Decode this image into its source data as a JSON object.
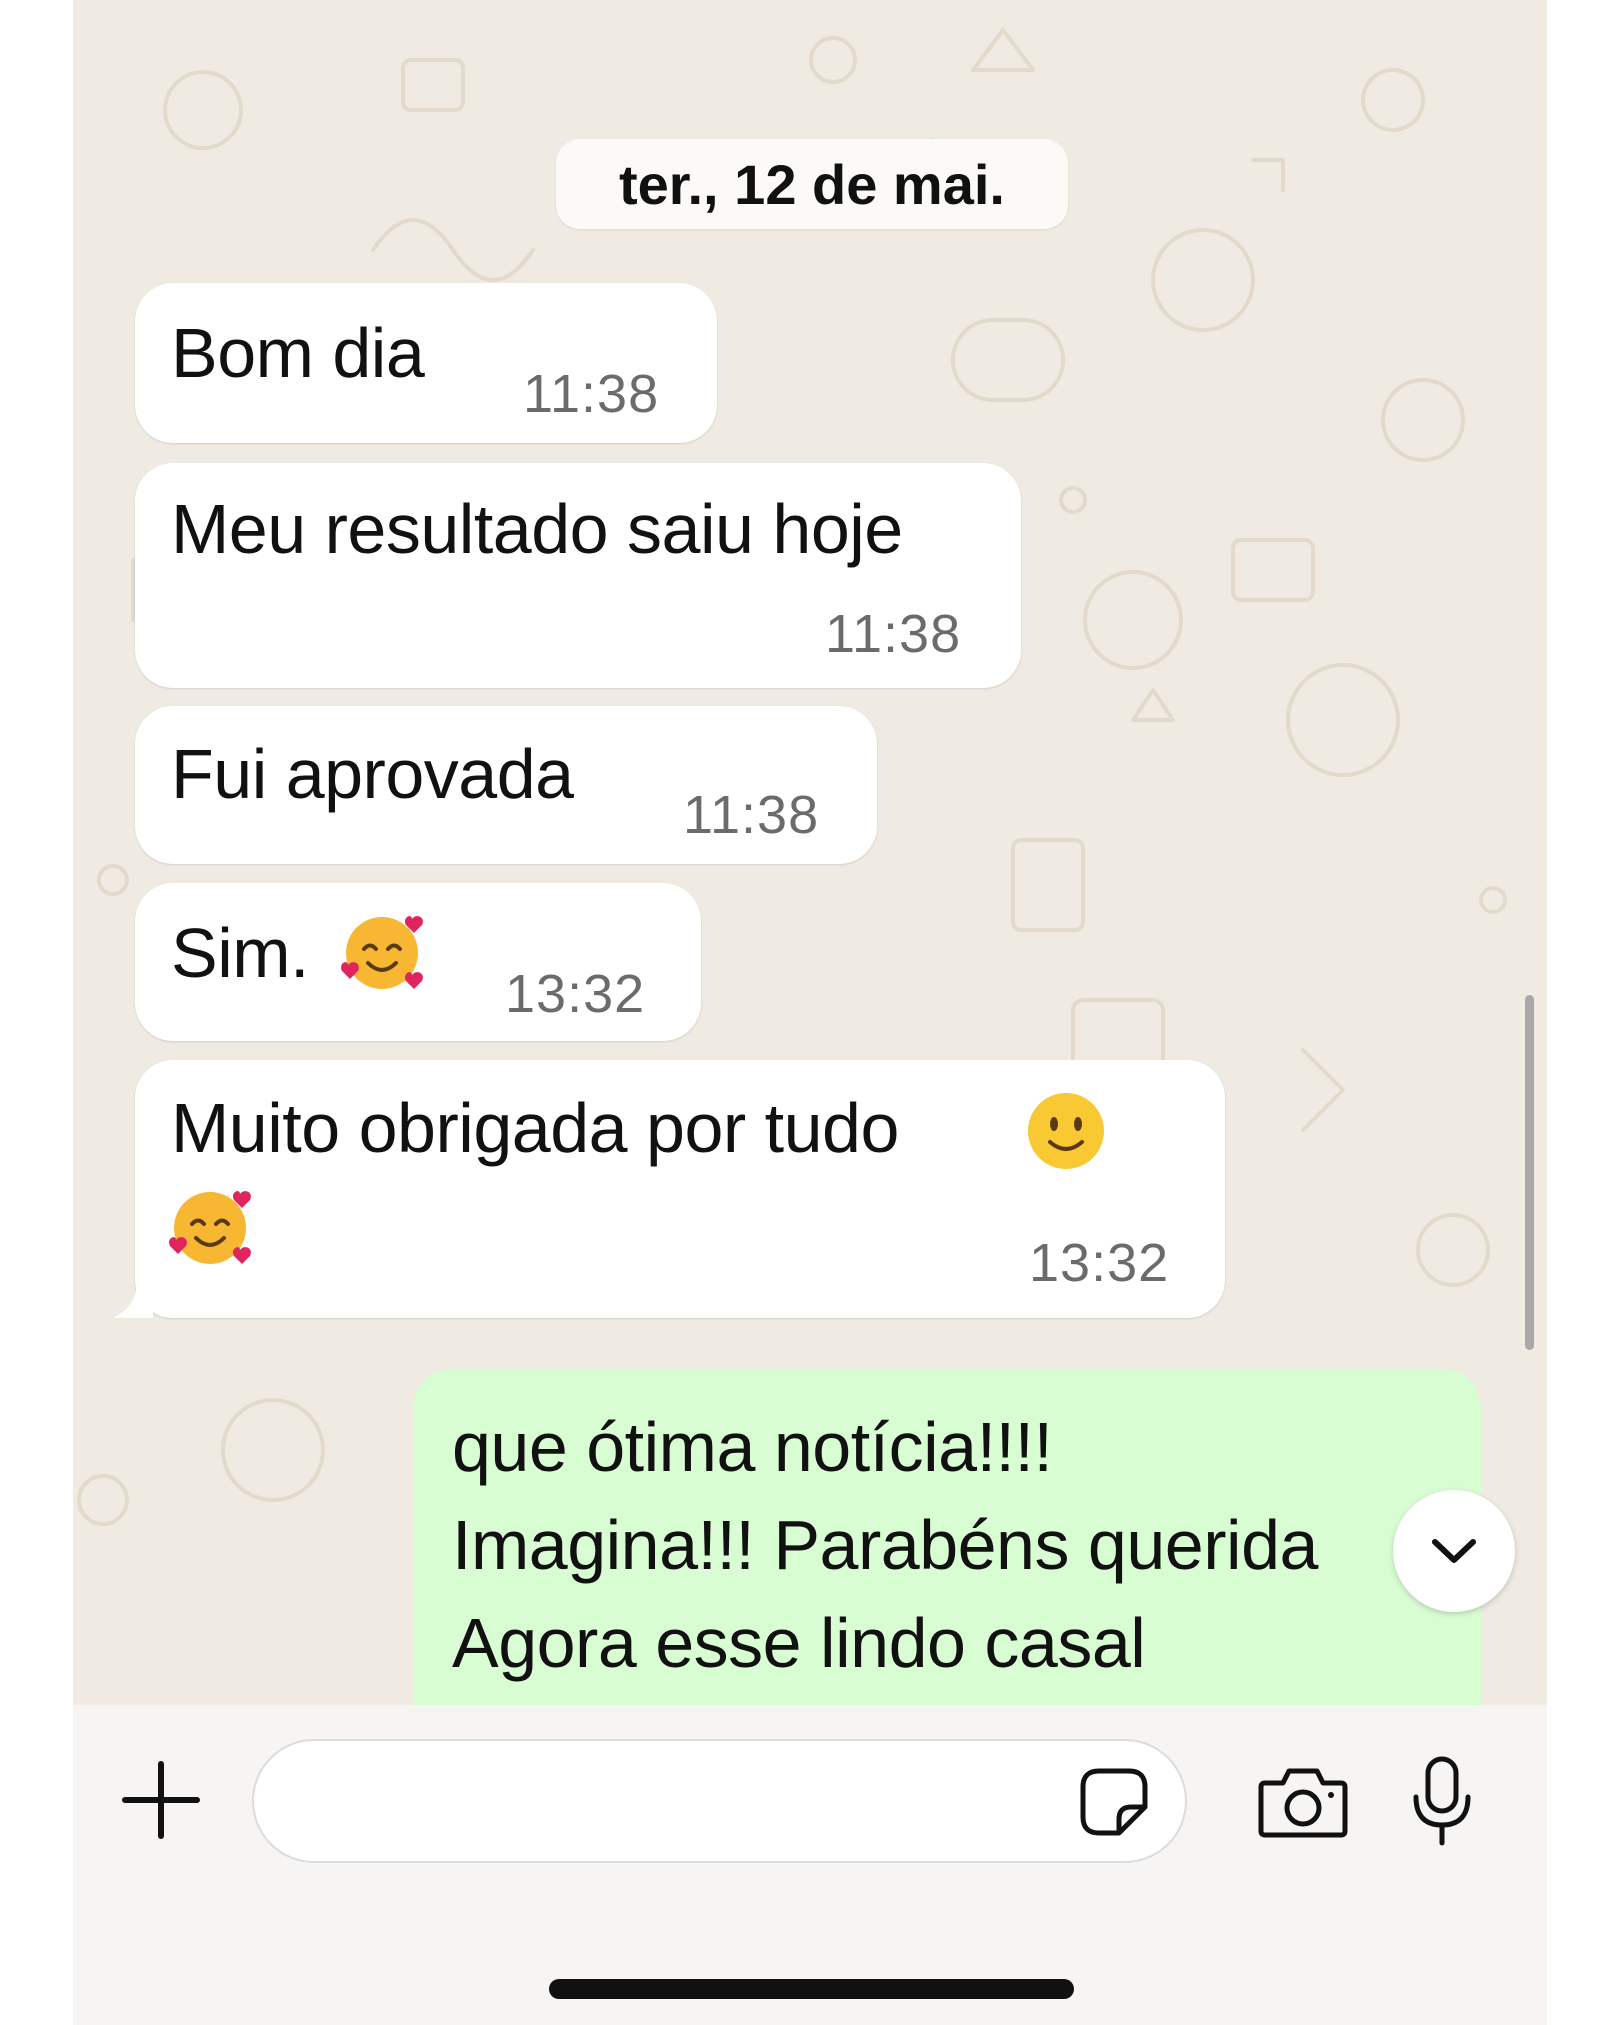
{
  "chat": {
    "date_separator": "ter., 12 de mai.",
    "received_messages": [
      {
        "text": "Bom dia",
        "time": "11:38"
      },
      {
        "text": "Meu resultado saiu hoje",
        "time": "11:38"
      },
      {
        "text": "Fui aprovada",
        "time": "11:38"
      },
      {
        "text": "Sim.",
        "emoji": "smiling-face-with-hearts",
        "time": "13:32"
      },
      {
        "text": "Muito obrigada por tudo",
        "emoji": [
          "slightly-smiling-face",
          "smiling-face-with-hearts"
        ],
        "time": "13:32"
      }
    ],
    "sent_message": {
      "lines": [
        "que ótima notícia!!!!",
        "Imagina!!! Parabéns querida",
        "Agora esse lindo casal"
      ]
    }
  },
  "composer": {
    "placeholder": "",
    "icons": [
      "plus-icon",
      "sticker-icon",
      "camera-icon",
      "microphone-icon"
    ]
  },
  "scroll_button_icon": "chevron-down-icon",
  "colors": {
    "chat_background": "#efeae2",
    "received_bubble": "#ffffff",
    "sent_bubble": "#d9fdd3",
    "timestamp": "#6b6b6b"
  }
}
